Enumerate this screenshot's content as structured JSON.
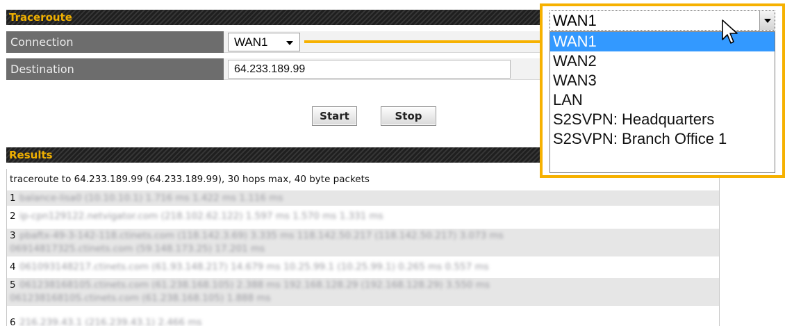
{
  "traceroute": {
    "title": "Traceroute",
    "connection_label": "Connection",
    "connection_value": "WAN1",
    "destination_label": "Destination",
    "destination_value": "64.233.189.99",
    "start_label": "Start",
    "stop_label": "Stop"
  },
  "results": {
    "title": "Results",
    "header_line": "traceroute to 64.233.189.99 (64.233.189.99), 30 hops max, 40 byte packets",
    "lines": [
      {
        "hop": "1",
        "text": "balance-lisa0 (10.10.10.1) 1.716 ms 1.422 ms 1.116 ms"
      },
      {
        "hop": "2",
        "text": "ip-cpn129122.netvigator.com (218.102.62.122) 1.597 ms 1.570 ms 1.331 ms"
      },
      {
        "hop": "3",
        "text": "pbaftx-49-3-142-118.ctinets.com (118.142.3.69) 3.335 ms 118.142.50.217 (118.142.50.217) 3.073 ms",
        "cont": "06914817325.ctinets.com (59.148.173.25) 17.201 ms"
      },
      {
        "hop": "4",
        "text": "061093148217.ctinets.com (61.93.148.217) 14.679 ms 10.25.99.1 (10.25.99.1) 0.265 ms 0.557 ms"
      },
      {
        "hop": "5",
        "text": "061238168105.ctinets.com (61.238.168.105) 2.388 ms 192.168.128.29 (192.168.128.29) 3.550 ms",
        "cont": "06123816810S.ctinets.com (61.238.168.105) 1.888 ms"
      },
      {
        "hop": "6",
        "text": "216.239.43.1 (216.239.43.1) 2.466 ms"
      }
    ]
  },
  "dropdown": {
    "selected_value": "WAN1",
    "options": [
      "WAN1",
      "WAN2",
      "WAN3",
      "LAN",
      "S2SVPN: Headquarters",
      "S2SVPN: Branch Office 1"
    ]
  },
  "colors": {
    "header_text": "#f0b000",
    "callout": "#f6b100",
    "highlight": "#3399ff",
    "label_bg": "#6d6d6d"
  },
  "icons": {
    "pointer": "mouse-pointer-icon"
  }
}
